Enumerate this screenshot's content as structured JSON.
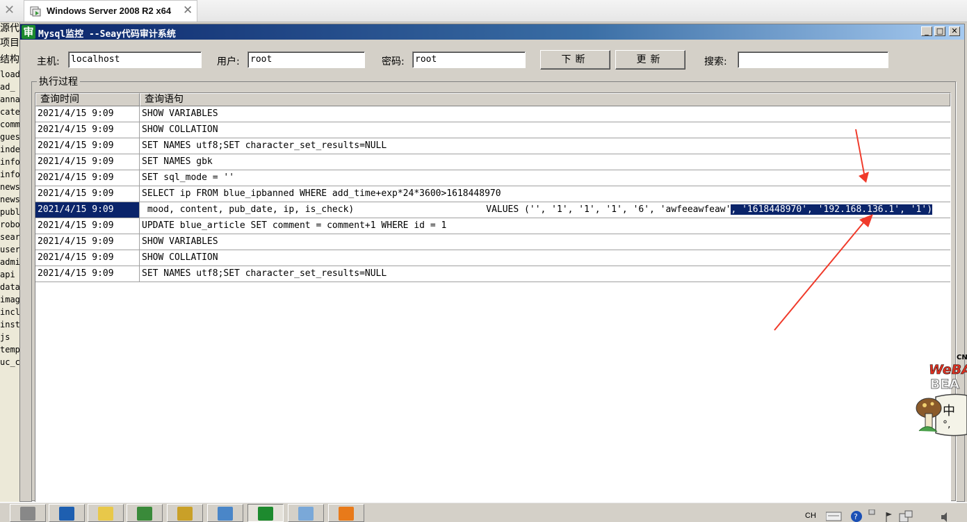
{
  "vm_tab": {
    "title": "Windows Server 2008 R2 x64",
    "close": "✕",
    "strip_close": "✕"
  },
  "background_panel": {
    "header": "源代",
    "items_cn": [
      "项目",
      "结构"
    ],
    "items": [
      "load",
      "ad_",
      "anna",
      "cate",
      "comm",
      "gues",
      "inde",
      "info",
      "info",
      "news",
      "news",
      "publ",
      "robo",
      "sear",
      "user",
      "admi",
      "api",
      "data",
      "imag",
      "incl",
      "inst",
      "js",
      "temp",
      "uc_c"
    ]
  },
  "window": {
    "title": "Mysql监控 --Seay代码审计系统",
    "app_icon": "审",
    "icons": {
      "app": "audit-icon",
      "min": "minimize-icon",
      "max": "maximize-icon",
      "close": "close-icon"
    }
  },
  "toolbar": {
    "host_label": "主机:",
    "host_value": "localhost",
    "user_label": "用户:",
    "user_value": "root",
    "password_label": "密码:",
    "password_value": "root",
    "break_button": "下断",
    "update_button": "更新",
    "search_label": "搜索:",
    "search_value": ""
  },
  "group": {
    "label": "执行过程"
  },
  "table": {
    "columns": [
      "查询时间",
      "查询语句"
    ],
    "rows": [
      {
        "time": "2021/4/15 9:09",
        "query": "SHOW VARIABLES"
      },
      {
        "time": "2021/4/15 9:09",
        "query": "SHOW COLLATION"
      },
      {
        "time": "2021/4/15 9:09",
        "query": "SET NAMES utf8;SET character_set_results=NULL"
      },
      {
        "time": "2021/4/15 9:09",
        "query": "SET NAMES gbk"
      },
      {
        "time": "2021/4/15 9:09",
        "query": "SET sql_mode = ''"
      },
      {
        "time": "2021/4/15 9:09",
        "query": "SELECT ip FROM blue_ipbanned WHERE add_time+exp*24*3600>1618448970"
      },
      {
        "time": "2021/4/15 9:09",
        "query_part1": " mood, content, pub_date, ip, is_check)",
        "query_part2": "VALUES ('', '1', '1', '1', '6', 'awfeeawfeaw'",
        "query_selected": ", '1618448970', '192.168.136.1', '1')"
      },
      {
        "time": "2021/4/15 9:09",
        "query": "UPDATE blue_article SET comment = comment+1 WHERE id = 1"
      },
      {
        "time": "2021/4/15 9:09",
        "query": "SHOW VARIABLES"
      },
      {
        "time": "2021/4/15 9:09",
        "query": "SHOW COLLATION"
      },
      {
        "time": "2021/4/15 9:09",
        "query": "SET NAMES utf8;SET character_set_results=NULL"
      }
    ]
  },
  "annotation": {
    "arrow_color": "#f03a2a"
  },
  "mascot": {
    "logo_top": "CN",
    "logo_line1": "WeBA",
    "logo_line2": "BEA",
    "ime_text": "中",
    "ime_sub": "°,"
  },
  "taskbar": {
    "apps": [
      "server-manager-icon",
      "powershell-icon",
      "explorer-icon",
      "network-icon",
      "archive-icon",
      "notepad-icon",
      "seay-audit-icon",
      "eraser-icon",
      "sublime-icon"
    ],
    "tray_lang": "CH",
    "tray_icons": [
      "keyboard-icon",
      "help-icon",
      "notification-icon",
      "flag-icon",
      "network-tray-icon",
      "volume-icon"
    ]
  }
}
